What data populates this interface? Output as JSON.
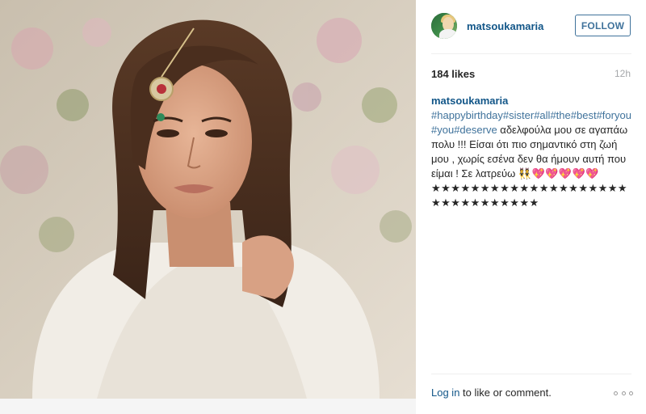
{
  "post": {
    "photo_icon": "portrait-photo",
    "username": "matsoukamaria",
    "follow_label": "FOLLOW",
    "likes": "184 likes",
    "time": "12h",
    "caption": {
      "username": "matsoukamaria",
      "tags": [
        "#happybirthday",
        "#sister",
        "#all",
        "#the",
        "#best",
        "#foryou",
        "#you",
        "#deserve"
      ],
      "text": " αδελφούλα μου σε αγαπάω πολυ !!! Είσαι ότι πιο σημαντικό στη ζωή μου , χωρίς εσένα δεν θα ήμουν αυτή που είμαι ! Σε λατρεύω ",
      "emoji": "👯💖💖💖💖💖★★★★★★★★★★★★★★★★★★★★★★★★★★★★★★★"
    },
    "footer": {
      "login_label": "Log in",
      "rest_label": " to like or comment."
    }
  },
  "colors": {
    "link": "#125688",
    "hashtag": "#3f729b",
    "follow_border": "#3f729b",
    "muted": "#a5a7aa"
  }
}
